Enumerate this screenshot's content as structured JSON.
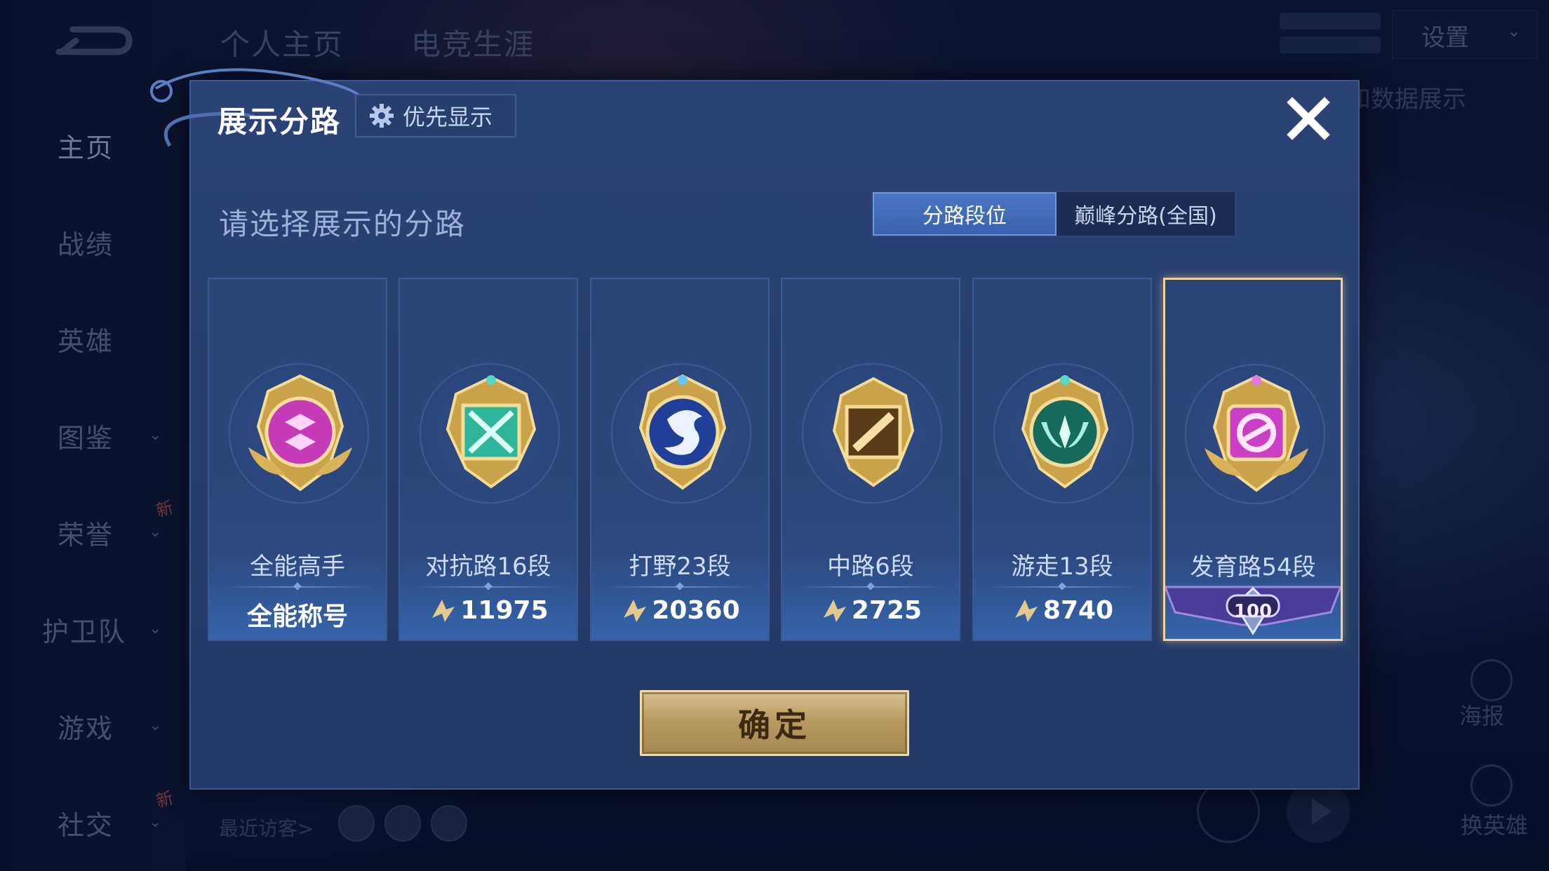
{
  "nav": {
    "items": [
      {
        "label": "主页",
        "chevron": false,
        "new": false
      },
      {
        "label": "战绩",
        "chevron": false,
        "new": false
      },
      {
        "label": "英雄",
        "chevron": false,
        "new": false
      },
      {
        "label": "图鉴",
        "chevron": true,
        "new": false
      },
      {
        "label": "荣誉",
        "chevron": true,
        "new": true
      },
      {
        "label": "护卫队",
        "chevron": true,
        "new": false
      },
      {
        "label": "游戏",
        "chevron": true,
        "new": false
      },
      {
        "label": "社交",
        "chevron": true,
        "new": true
      }
    ],
    "new_tag": "新"
  },
  "top_tabs": [
    "个人主页",
    "电竞生涯"
  ],
  "settings_label": "设置",
  "data_show_label": "和数据展示",
  "side": {
    "poster": "海报",
    "change_hero": "换英雄"
  },
  "visitors_label": "最近访客>",
  "dialog": {
    "title": "展示分路",
    "priority_label": "优先显示",
    "subtitle": "请选择展示的分路",
    "tabs": {
      "active": "分路段位",
      "inactive": "巅峰分路(全国)"
    },
    "cards": [
      {
        "rank": "全能高手",
        "value": "全能称号",
        "icon": "all-round-emblem-icon",
        "color": "#c53bb8"
      },
      {
        "rank": "对抗路16段",
        "value": "11975",
        "icon": "clash-lane-emblem-icon",
        "color": "#2fb59a"
      },
      {
        "rank": "打野23段",
        "value": "20360",
        "icon": "jungle-emblem-icon",
        "color": "#2d63c8"
      },
      {
        "rank": "中路6段",
        "value": "2725",
        "icon": "mid-lane-emblem-icon",
        "color": "#9a6a2a"
      },
      {
        "rank": "游走13段",
        "value": "8740",
        "icon": "roam-emblem-icon",
        "color": "#1f8a74"
      },
      {
        "rank": "发育路54段",
        "value": "100",
        "icon": "farm-lane-emblem-icon",
        "color": "#c93fc6"
      }
    ],
    "confirm_label": "确定"
  }
}
